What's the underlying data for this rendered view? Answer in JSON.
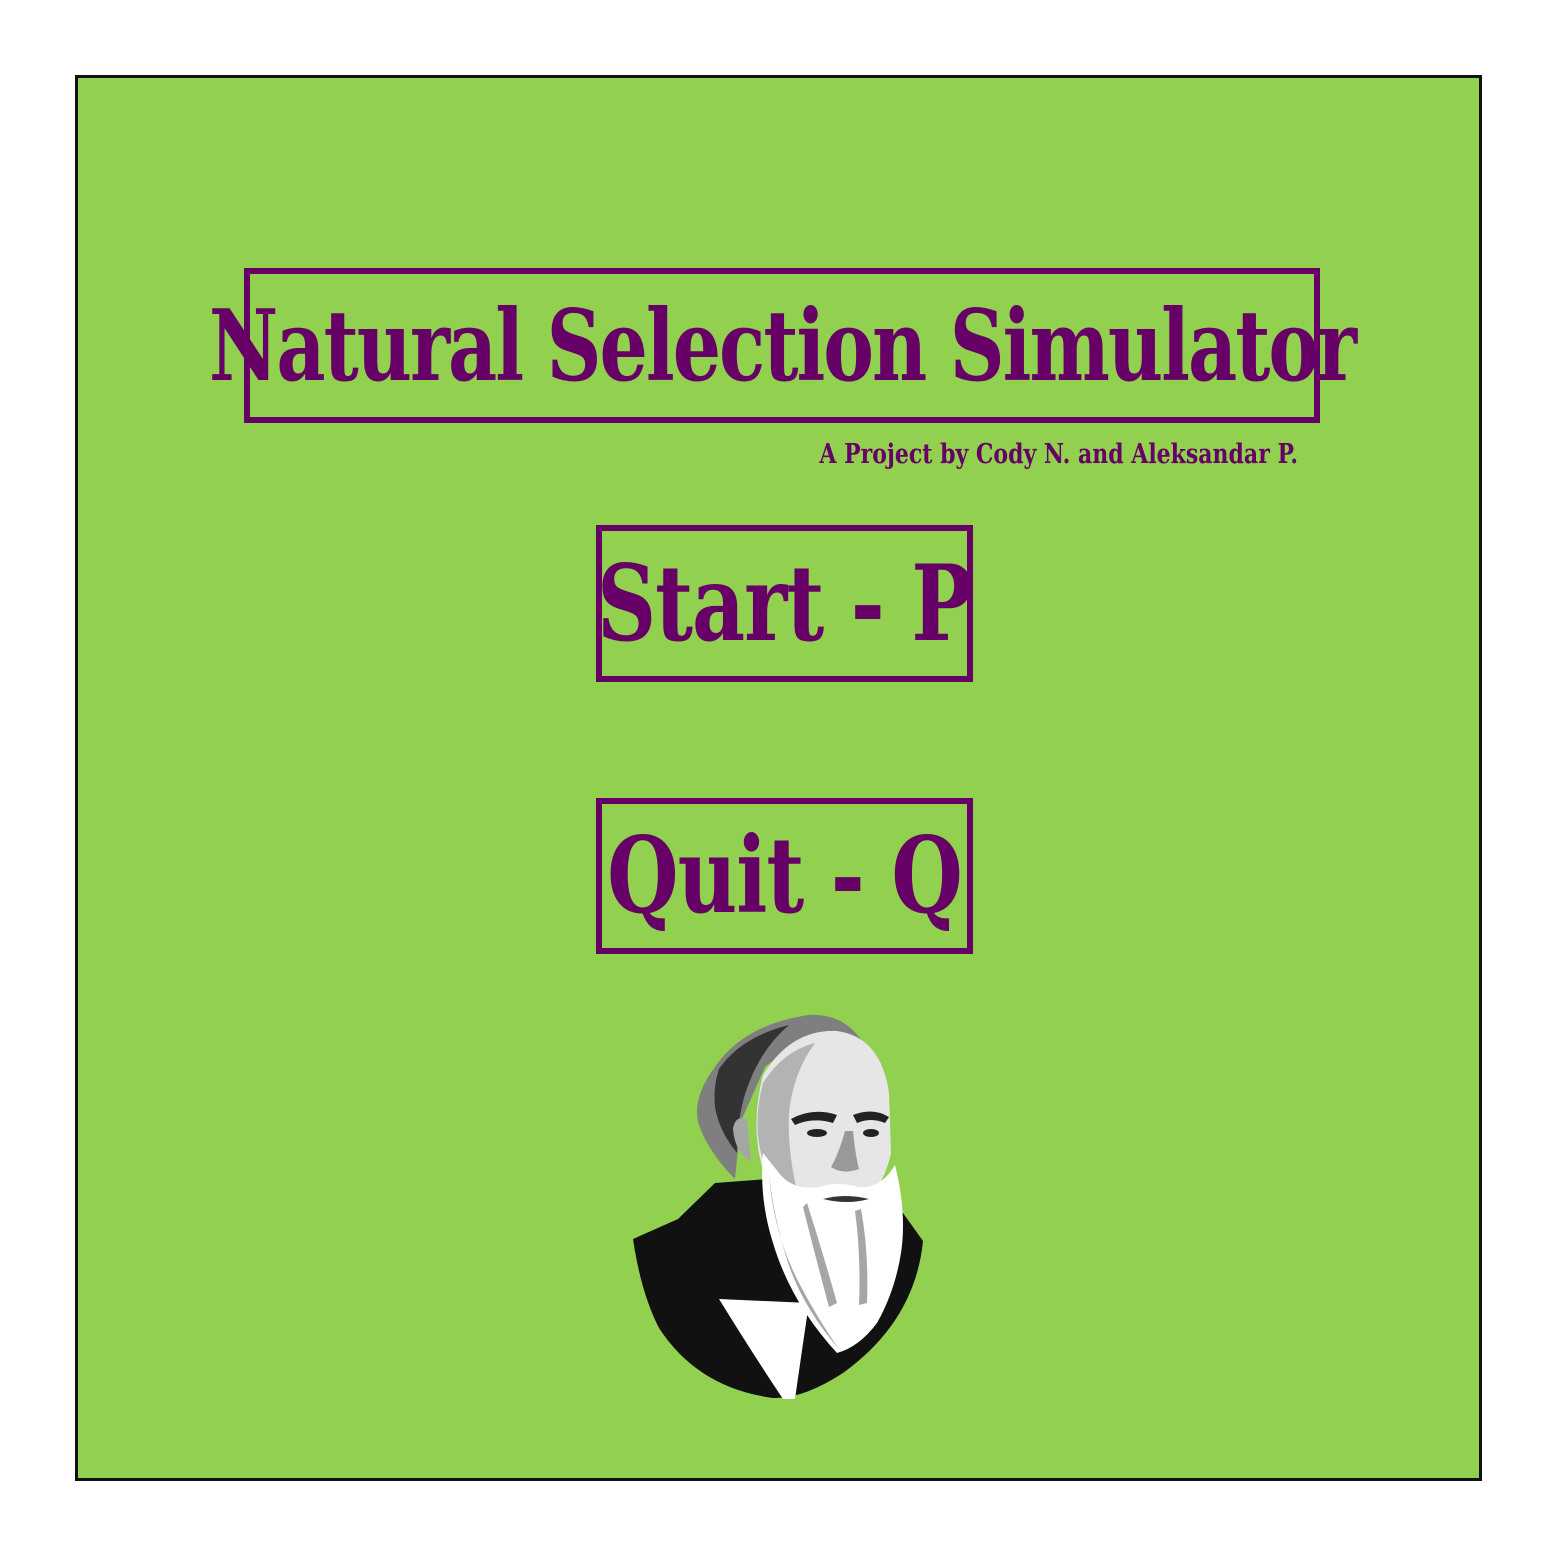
{
  "menu": {
    "title": "Natural Selection Simulator",
    "subtitle": "A Project by Cody N. and Aleksandar P.",
    "start_label": "Start - P",
    "quit_label": "Quit - Q"
  },
  "portrait": {
    "icon": "bearded-scientist-portrait"
  },
  "colors": {
    "background": "#92d050",
    "accent": "#660066",
    "border": "#111111"
  }
}
